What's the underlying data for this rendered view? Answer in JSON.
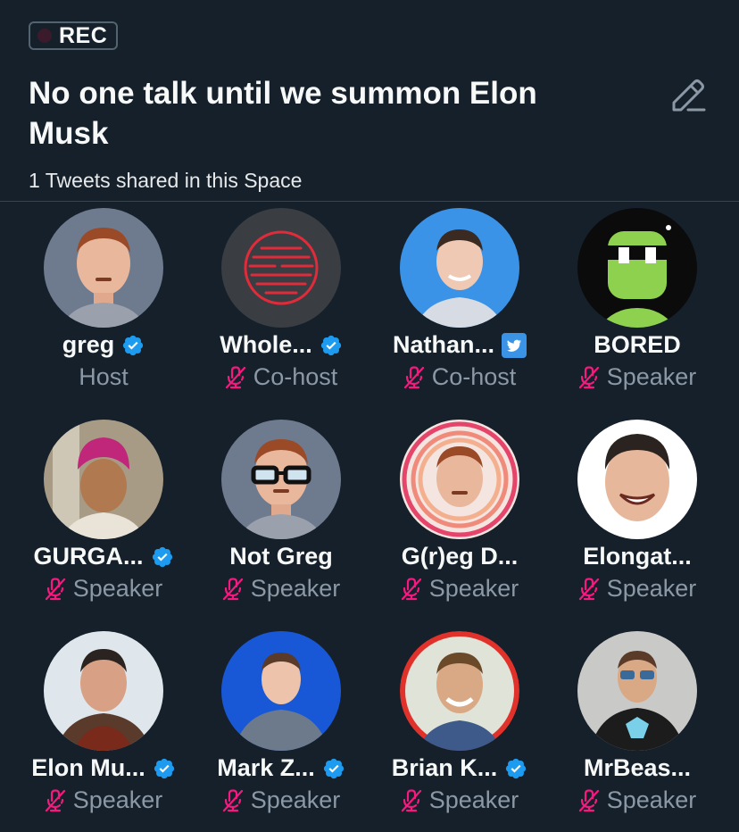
{
  "header": {
    "rec_label": "REC",
    "title": "No one talk until we summon Elon Musk",
    "subtitle": "1 Tweets shared in this Space",
    "edit_icon": "pencil-edit-icon"
  },
  "colors": {
    "background": "#15202b",
    "verified_badge": "#1d9bf0",
    "muted_mic": "#f91880",
    "role_text": "#8b98a5"
  },
  "participants": [
    {
      "name": "greg",
      "role": "Host",
      "verified": true,
      "muted": false
    },
    {
      "name": "Whole...",
      "role": "Co-host",
      "verified": true,
      "muted": true
    },
    {
      "name": "Nathan...",
      "role": "Co-host",
      "verified": "twitter-square",
      "muted": true
    },
    {
      "name": "BORED",
      "role": "Speaker",
      "verified": false,
      "muted": true
    },
    {
      "name": "GURGA...",
      "role": "Speaker",
      "verified": true,
      "muted": true
    },
    {
      "name": "Not Greg",
      "role": "Speaker",
      "verified": false,
      "muted": true
    },
    {
      "name": "G(r)eg D...",
      "role": "Speaker",
      "verified": false,
      "muted": true
    },
    {
      "name": "Elongat...",
      "role": "Speaker",
      "verified": false,
      "muted": true
    },
    {
      "name": "Elon Mu...",
      "role": "Speaker",
      "verified": true,
      "muted": true
    },
    {
      "name": "Mark Z...",
      "role": "Speaker",
      "verified": true,
      "muted": true
    },
    {
      "name": "Brian K...",
      "role": "Speaker",
      "verified": true,
      "muted": true
    },
    {
      "name": "MrBeas...",
      "role": "Speaker",
      "verified": false,
      "muted": true
    }
  ]
}
